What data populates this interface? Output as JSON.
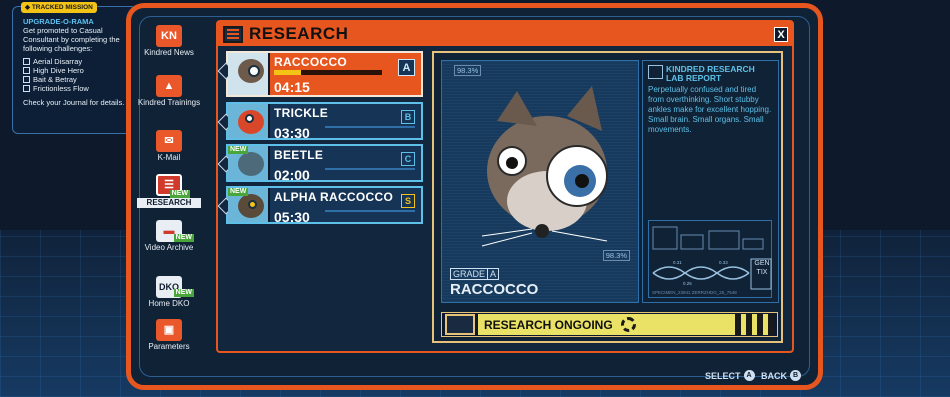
{
  "mission": {
    "tag": "TRACKED MISSION",
    "title": "UPGRADE-O-RAMA",
    "description": "Get promoted to Casual Consultant by completing the following challenges:",
    "challenges": [
      "Aerial Disarray",
      "High Dive Hero",
      "Bait & Betray",
      "Frictionless Flow"
    ],
    "footer": "Check your Journal for details."
  },
  "nav": {
    "items": [
      {
        "label": "Kindred News",
        "icon": "kindred-news-icon"
      },
      {
        "label": "Kindred Trainings",
        "icon": "trainings-icon"
      },
      {
        "label": "K-Mail",
        "icon": "mail-icon"
      },
      {
        "label": "RESEARCH",
        "icon": "research-icon",
        "badge": "NEW",
        "active": true
      },
      {
        "label": "Video Archive",
        "icon": "video-archive-icon",
        "badge": "NEW"
      },
      {
        "label": "Home DKO",
        "icon": "home-dko-icon",
        "badge": "NEW"
      },
      {
        "label": "Parameters",
        "icon": "parameters-icon"
      }
    ],
    "icon_text": {
      "news": "KN",
      "dko": "DKO"
    }
  },
  "research": {
    "title": "RESEARCH",
    "close_label": "X",
    "creatures": [
      {
        "name": "RACCOCCO",
        "time": "04:15",
        "grade": "A",
        "selected": true,
        "progress": 0.25
      },
      {
        "name": "TRICKLE",
        "time": "03:30",
        "grade": "B"
      },
      {
        "name": "BEETLE",
        "time": "02:00",
        "grade": "C",
        "badge": "NEW"
      },
      {
        "name": "ALPHA RACCOCCO",
        "time": "05:30",
        "grade": "S",
        "badge": "NEW"
      }
    ],
    "detail": {
      "readout_top": "98.3%",
      "readout_bottom": "98.3%",
      "grade_label": "GRADE",
      "grade": "A",
      "name": "RACCOCCO",
      "report_title": "KINDRED RESEARCH LAB REPORT",
      "report_text": "Perpetually confused and tired from overthinking. Short stubby ankles make for excellent hopping. Small brain. Small organs. Small movements.",
      "dna_side_label": "GEN TIX",
      "dna_values": [
        "0.31",
        "0.33",
        "0.25"
      ],
      "dna_code": "SPECIMEN_23941 ZERRZHDG_25_7648"
    },
    "status": "RESEARCH ONGOING"
  },
  "footer": {
    "select_label": "SELECT",
    "select_button": "A",
    "back_label": "BACK",
    "back_button": "B"
  },
  "colors": {
    "accent": "#e7561e",
    "highlight": "#eae266",
    "cyan": "#5ec0e8"
  }
}
